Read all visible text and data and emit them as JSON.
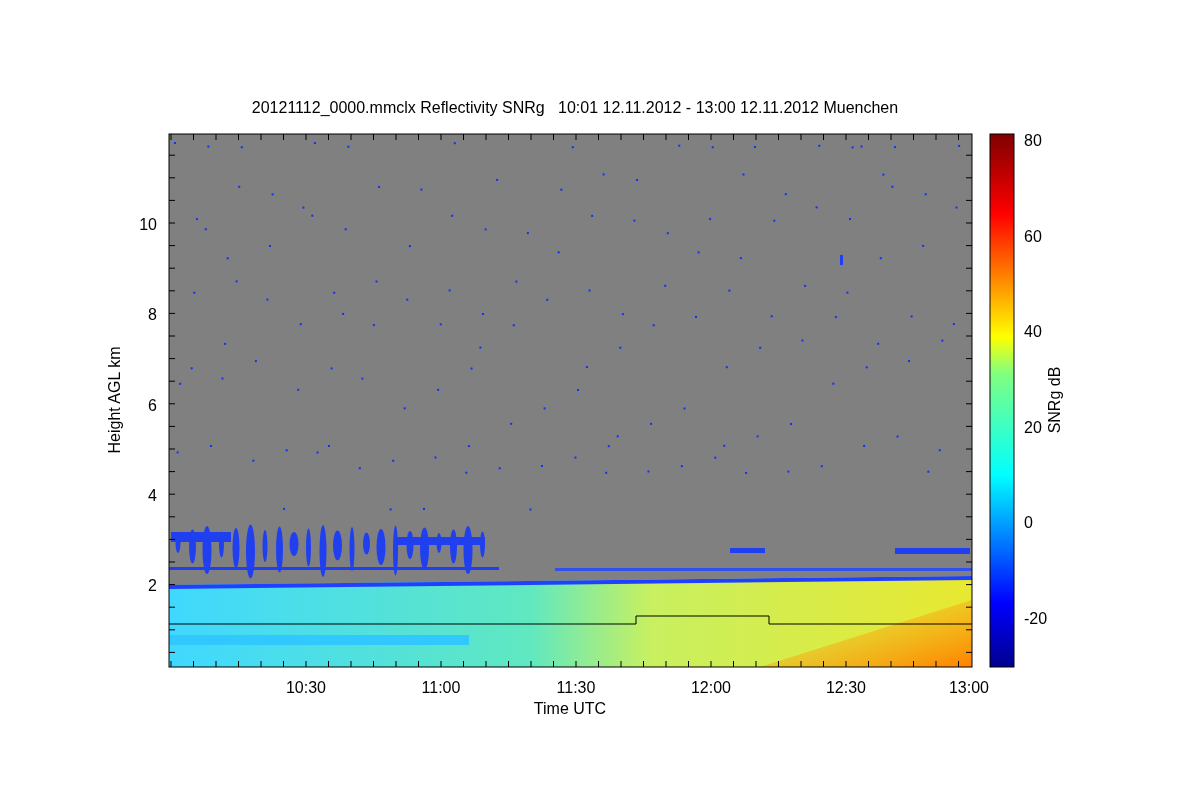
{
  "title": "20121112_0000.mmclx Reflectivity SNRg   10:01 12.11.2012 - 13:00 12.11.2012 Muenchen",
  "y_axis": {
    "label": "Height AGL km",
    "ticks": [
      "10",
      "8",
      "6",
      "4",
      "2"
    ]
  },
  "x_axis": {
    "label": "Time UTC",
    "ticks": [
      "10:30",
      "11:00",
      "11:30",
      "12:00",
      "12:30",
      "13:00"
    ]
  },
  "colorbar": {
    "label": "SNRg dB",
    "ticks": [
      "80",
      "60",
      "40",
      "20",
      "0",
      "-20"
    ]
  }
}
